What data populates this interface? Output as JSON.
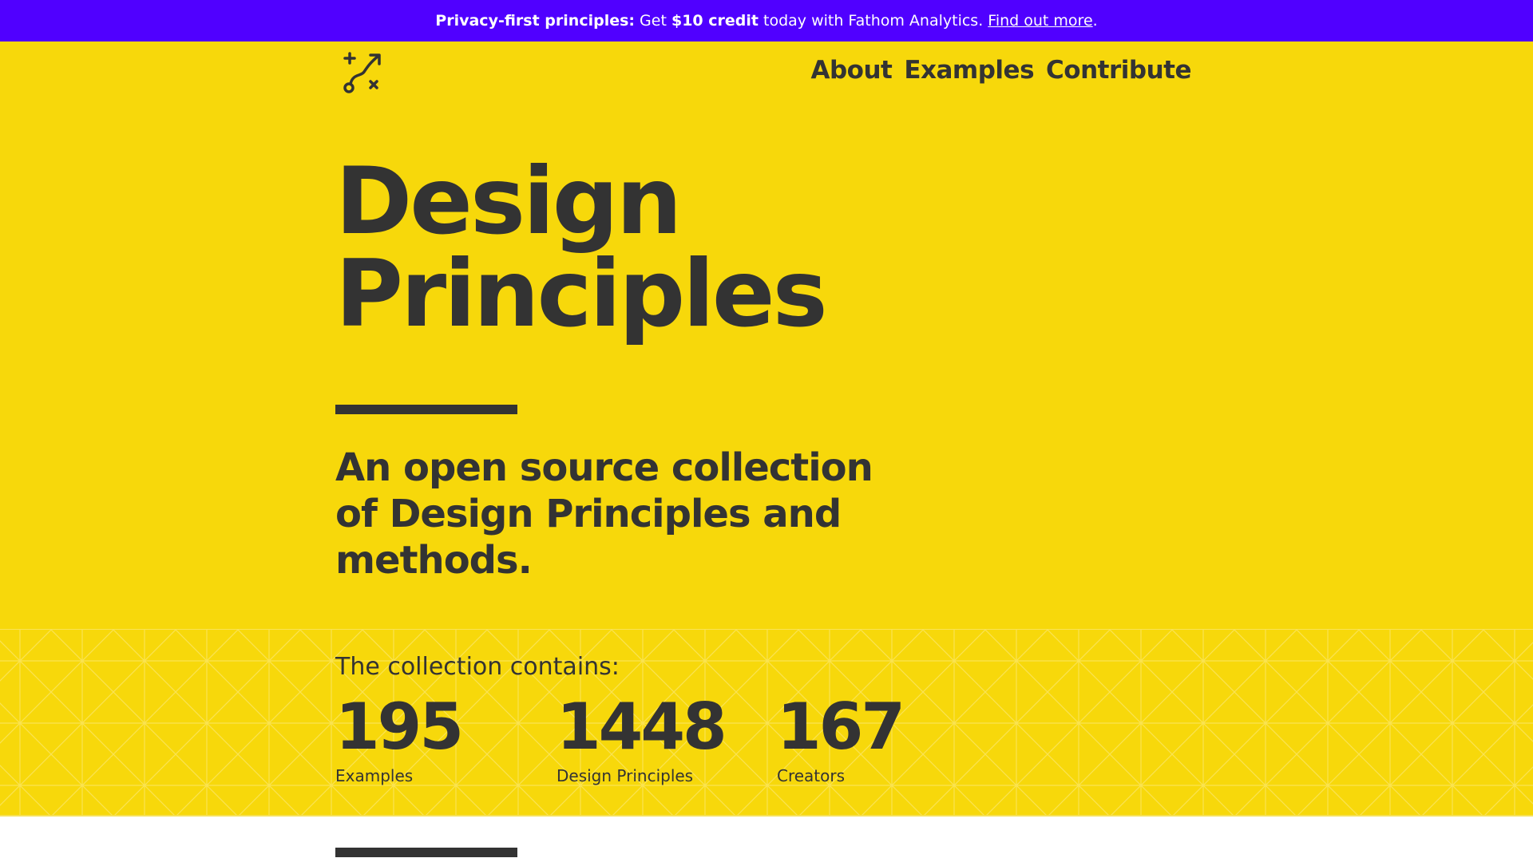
{
  "banner": {
    "lead": "Privacy-first principles:",
    "get": "Get",
    "credit": "$10 credit",
    "rest": "today with Fathom Analytics.",
    "link": "Find out more",
    "period": "."
  },
  "nav": {
    "about": "About",
    "examples": "Examples",
    "contribute": "Contribute"
  },
  "logo_icon": "route-arrow-icon",
  "hero": {
    "title_line1": "Design",
    "title_line2": "Principles",
    "subtitle": "An open source collection of Design Principles and methods."
  },
  "stats": {
    "heading": "The collection contains:",
    "items": [
      {
        "number": "195",
        "label": "Examples"
      },
      {
        "number": "1448",
        "label": "Design Principles"
      },
      {
        "number": "167",
        "label": "Creators"
      }
    ]
  },
  "colors": {
    "banner": "#5000ff",
    "hero": "#f7d80b",
    "text": "#333333"
  }
}
